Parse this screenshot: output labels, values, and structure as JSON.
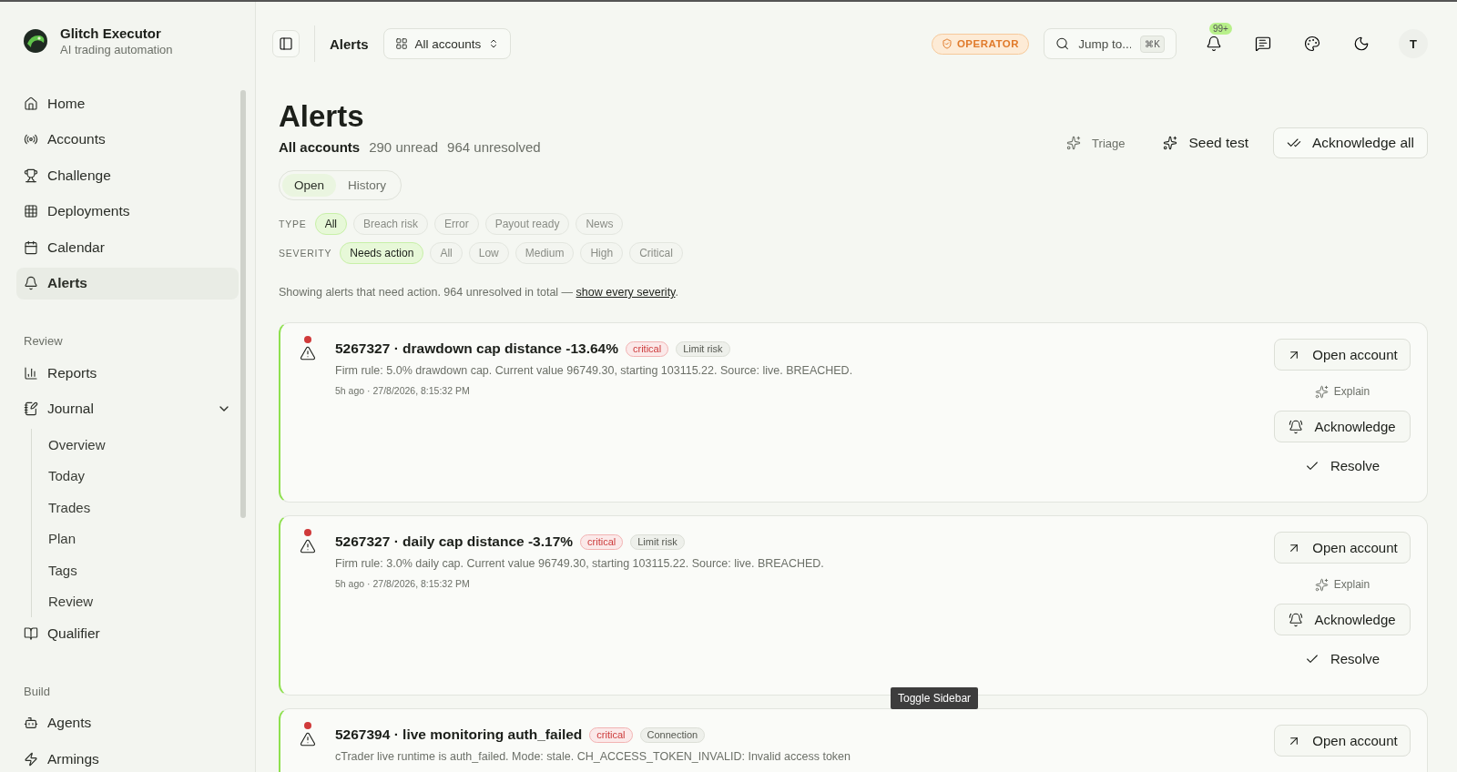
{
  "brand": {
    "name": "Glitch Executor",
    "tagline": "AI trading automation"
  },
  "sidebar": {
    "sections": [
      {
        "items": [
          {
            "label": "Home",
            "selected": false
          },
          {
            "label": "Accounts",
            "selected": false
          },
          {
            "label": "Challenge",
            "selected": false
          },
          {
            "label": "Deployments",
            "selected": false
          },
          {
            "label": "Calendar",
            "selected": false
          },
          {
            "label": "Alerts",
            "selected": true
          }
        ]
      },
      {
        "label": "Review",
        "items": [
          {
            "label": "Reports",
            "selected": false
          },
          {
            "label": "Journal",
            "selected": false,
            "expanded": true,
            "children": [
              {
                "label": "Overview"
              },
              {
                "label": "Today"
              },
              {
                "label": "Trades"
              },
              {
                "label": "Plan"
              },
              {
                "label": "Tags"
              },
              {
                "label": "Review"
              }
            ]
          },
          {
            "label": "Qualifier",
            "selected": false
          }
        ]
      },
      {
        "label": "Build",
        "items": [
          {
            "label": "Agents",
            "selected": false
          },
          {
            "label": "Armings",
            "selected": false
          }
        ]
      }
    ]
  },
  "topbar": {
    "breadcrumb": "Alerts",
    "account_selector": "All accounts",
    "role_badge": "OPERATOR",
    "search": {
      "placeholder": "Jump to...",
      "shortcut": "⌘K"
    },
    "notification_count": "99+",
    "avatar": "T"
  },
  "page": {
    "title": "Alerts",
    "scope": "All accounts",
    "unread": "290 unread",
    "unresolved": "964 unresolved",
    "actions": [
      {
        "label": "Triage",
        "kind": "ghost"
      },
      {
        "label": "Seed test",
        "kind": "ghost-strong"
      },
      {
        "label": "Acknowledge all",
        "kind": "outline"
      }
    ],
    "tabs": [
      {
        "label": "Open",
        "selected": true
      },
      {
        "label": "History",
        "selected": false
      }
    ],
    "filters": [
      {
        "label": "TYPE",
        "options": [
          {
            "label": "All",
            "selected": true
          },
          {
            "label": "Breach risk",
            "selected": false
          },
          {
            "label": "Error",
            "selected": false
          },
          {
            "label": "Payout ready",
            "selected": false
          },
          {
            "label": "News",
            "selected": false
          }
        ]
      },
      {
        "label": "SEVERITY",
        "options": [
          {
            "label": "Needs action",
            "selected": true
          },
          {
            "label": "All",
            "selected": false
          },
          {
            "label": "Low",
            "selected": false
          },
          {
            "label": "Medium",
            "selected": false
          },
          {
            "label": "High",
            "selected": false
          },
          {
            "label": "Critical",
            "selected": false
          }
        ]
      }
    ],
    "notice": "Showing alerts that need action. 964 unresolved in total — ",
    "notice_link": "show every severity",
    "notice_end": "."
  },
  "alerts": [
    {
      "unread": true,
      "title": "5267327 · drawdown cap distance -13.64%",
      "tags": [
        {
          "label": "critical",
          "kind": "severity"
        },
        {
          "label": "Limit risk",
          "kind": "category"
        }
      ],
      "description": "Firm rule: 5.0% drawdown cap. Current value 96749.30, starting 103115.22. Source: live. BREACHED.",
      "time": "5h ago · 27/8/2026, 8:15:32 PM",
      "actions": [
        {
          "label": "Open account",
          "kind": "open"
        },
        {
          "label": "Explain",
          "kind": "explain"
        },
        {
          "label": "Acknowledge",
          "kind": "acknowledge"
        },
        {
          "label": "Resolve",
          "kind": "resolve"
        }
      ]
    },
    {
      "unread": true,
      "title": "5267327 · daily cap distance -3.17%",
      "tags": [
        {
          "label": "critical",
          "kind": "severity"
        },
        {
          "label": "Limit risk",
          "kind": "category"
        }
      ],
      "description": "Firm rule: 3.0% daily cap. Current value 96749.30, starting 103115.22. Source: live. BREACHED.",
      "time": "5h ago · 27/8/2026, 8:15:32 PM",
      "actions": [
        {
          "label": "Open account",
          "kind": "open"
        },
        {
          "label": "Explain",
          "kind": "explain"
        },
        {
          "label": "Acknowledge",
          "kind": "acknowledge"
        },
        {
          "label": "Resolve",
          "kind": "resolve"
        }
      ]
    },
    {
      "unread": true,
      "title": "5267394 · live monitoring auth_failed",
      "tags": [
        {
          "label": "critical",
          "kind": "severity"
        },
        {
          "label": "Connection",
          "kind": "category"
        }
      ],
      "description": "cTrader live runtime is auth_failed. Mode: stale. CH_ACCESS_TOKEN_INVALID: Invalid access token",
      "actions": [
        {
          "label": "Open account",
          "kind": "open"
        }
      ]
    }
  ],
  "tooltip": "Toggle Sidebar"
}
